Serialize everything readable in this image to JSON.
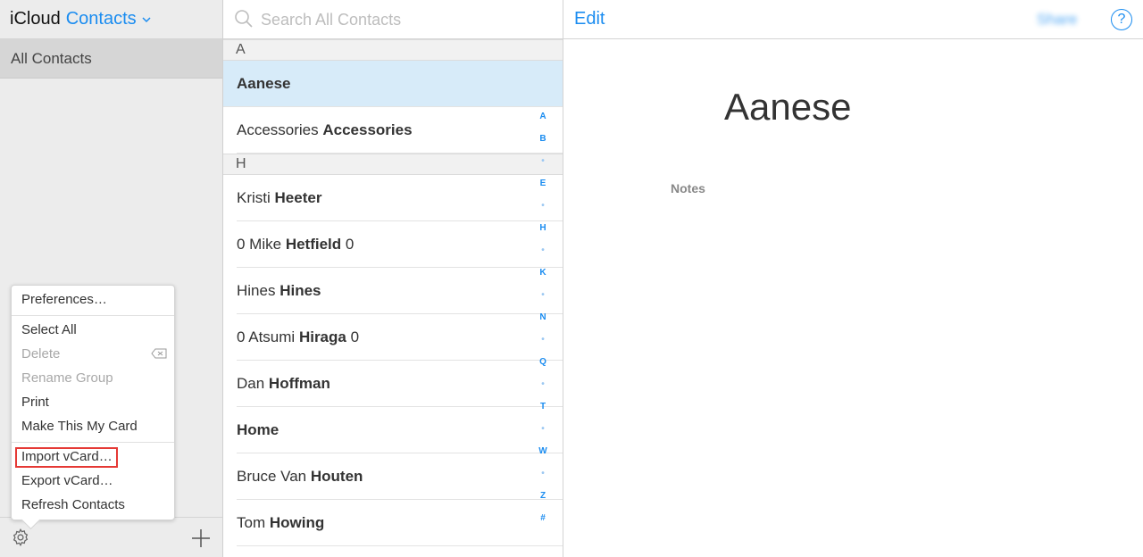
{
  "app": {
    "name": "iCloud",
    "section": "Contacts"
  },
  "sidebar": {
    "groups": [
      {
        "label": "All Contacts"
      }
    ]
  },
  "menu": {
    "items": [
      {
        "label": "Preferences…",
        "enabled": true
      },
      {
        "label": "Select All",
        "enabled": true
      },
      {
        "label": "Delete",
        "enabled": false
      },
      {
        "label": "Rename Group",
        "enabled": false
      },
      {
        "label": "Print",
        "enabled": true
      },
      {
        "label": "Make This My Card",
        "enabled": true
      },
      {
        "label": "Import vCard…",
        "enabled": true,
        "highlighted": true
      },
      {
        "label": "Export vCard…",
        "enabled": true
      },
      {
        "label": "Refresh Contacts",
        "enabled": true
      }
    ]
  },
  "search": {
    "placeholder": "Search All Contacts"
  },
  "contacts": {
    "sections": [
      {
        "letter": "A",
        "rows": [
          {
            "first": "",
            "last": "Aanese",
            "selected": true
          },
          {
            "first": "Accessories",
            "last": "Accessories"
          }
        ]
      },
      {
        "letter": "H",
        "rows": [
          {
            "first": "Kristi",
            "last": "Heeter"
          },
          {
            "first": "0 Mike",
            "last": "Hetfield",
            "suffix": "0"
          },
          {
            "first": "Hines",
            "last": "Hines"
          },
          {
            "first": "0 Atsumi",
            "last": "Hiraga",
            "suffix": "0"
          },
          {
            "first": "Dan",
            "last": "Hoffman"
          },
          {
            "first": "",
            "last": "Home"
          },
          {
            "first": "Bruce Van",
            "last": "Houten"
          },
          {
            "first": "Tom",
            "last": "Howing"
          }
        ]
      }
    ]
  },
  "index": [
    "A",
    "B",
    "•",
    "E",
    "•",
    "H",
    "•",
    "K",
    "•",
    "N",
    "•",
    "Q",
    "•",
    "T",
    "•",
    "W",
    "•",
    "Z",
    "#"
  ],
  "detail": {
    "edit_label": "Edit",
    "share_label": "Share",
    "help_label": "?",
    "name": "Aanese",
    "notes_label": "Notes"
  },
  "colors": {
    "accent": "#1a8cf0",
    "selected_row": "#d7ebf9",
    "highlight_box": "#e53935"
  }
}
